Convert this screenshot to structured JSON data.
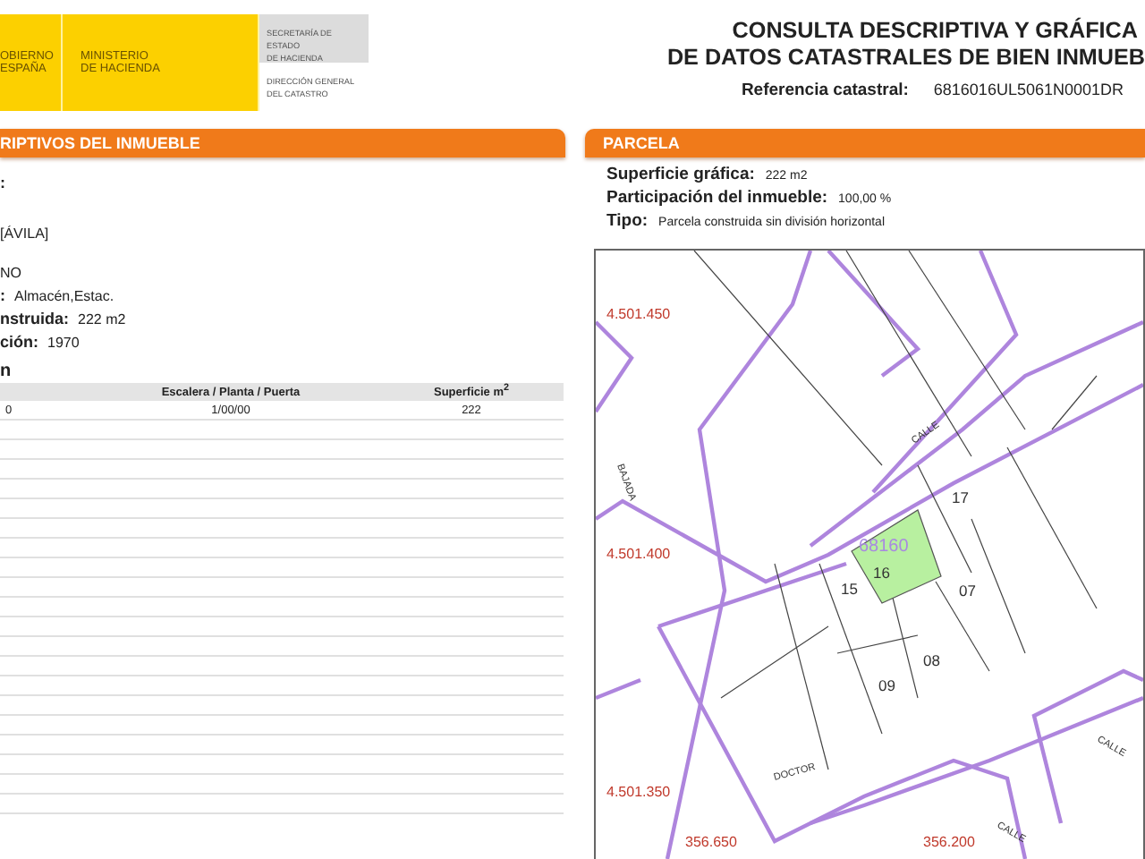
{
  "header": {
    "logo_blocks": [
      {
        "lines": [
          "OBIERNO",
          "ESPAÑA"
        ]
      },
      {
        "lines": [
          "MINISTERIO",
          "DE HACIENDA"
        ]
      }
    ],
    "agency_blocks": [
      {
        "kind": "grey",
        "lines": [
          "SECRETARÍA DE ESTADO",
          "DE HACIENDA"
        ]
      },
      {
        "kind": "plain",
        "lines": [
          "DIRECCIÓN GENERAL",
          "DEL CATASTRO"
        ]
      }
    ],
    "title_lines": [
      "CONSULTA DESCRIPTIVA Y GRÁFICA",
      "DE DATOS CATASTRALES DE BIEN INMUEB"
    ],
    "reference": {
      "label": "Referencia catastral:",
      "value": "6816016UL5061N0001DR"
    }
  },
  "left_panel": {
    "title": "RIPTIVOS DEL **INMUEBLE**",
    "fields": [
      {
        "label": ":"
      },
      {
        "value": "[ÁVILA]"
      },
      {
        "value": "NO"
      },
      {
        "label": ":",
        "value": "Almacén,Estac."
      },
      {
        "label": "nstruida:",
        "value": "222 m2"
      },
      {
        "label": "ción:",
        "value": "1970"
      }
    ],
    "section_title": "n",
    "table": {
      "columns": [
        "Escalera / Planta / Puerta",
        "Superficie m$^{2}$"
      ],
      "rows": [
        {
          "column_1": "0",
          "cells": [
            "1/00/00",
            "222"
          ]
        }
      ]
    }
  },
  "right_panel": {
    "title": "PARCELA",
    "fields": [
      {
        "label": "Superficie gráfica:",
        "value": "222 m2"
      },
      {
        "label": "Participación del inmueble:",
        "value": "100,00 %"
      },
      {
        "label": "Tipo:",
        "value": "Parcela construida sin división horizontal"
      }
    ],
    "map": {
      "labels": [
        {
          "kind": "coordinate",
          "text": "4.501.450"
        },
        {
          "kind": "coordinate",
          "text": "4.501.400"
        },
        {
          "kind": "coordinate",
          "text": "4.501.350"
        },
        {
          "kind": "coordinate",
          "text": "356.650"
        },
        {
          "kind": "coordinate",
          "text": "356.200"
        },
        {
          "kind": "parcel_ref",
          "text": "68160"
        },
        {
          "kind": "plot",
          "text": "17"
        },
        {
          "kind": "plot",
          "text": "16"
        },
        {
          "kind": "plot",
          "text": "15"
        },
        {
          "kind": "plot",
          "text": "07"
        },
        {
          "kind": "plot",
          "text": "08"
        },
        {
          "kind": "plot",
          "text": "09"
        },
        {
          "kind": "street",
          "text": "CALLE"
        },
        {
          "kind": "street",
          "text": "BAJADA"
        },
        {
          "kind": "street",
          "text": "DOCTOR"
        },
        {
          "kind": "street",
          "text": "CALLE"
        },
        {
          "kind": "street",
          "text": "CALLE"
        }
      ]
    }
  }
}
